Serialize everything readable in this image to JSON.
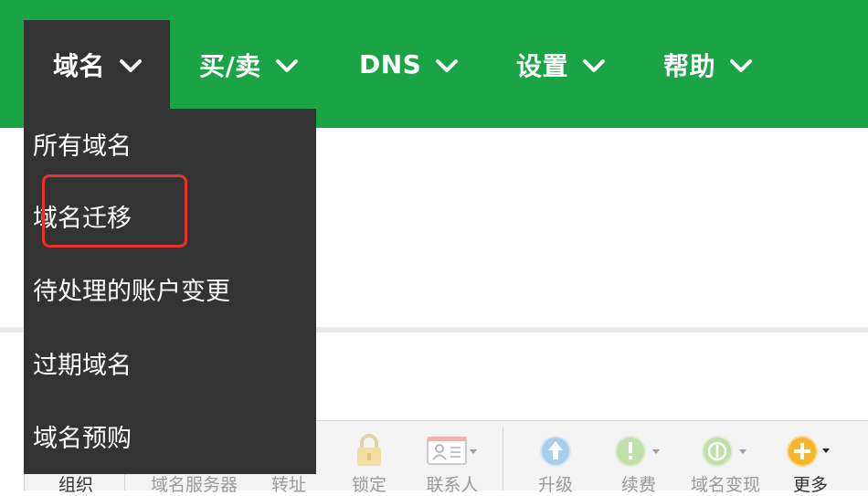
{
  "nav": {
    "items": [
      {
        "label": "域名",
        "active": true
      },
      {
        "label": "买/卖",
        "active": false
      },
      {
        "label": "DNS",
        "active": false
      },
      {
        "label": "设置",
        "active": false
      },
      {
        "label": "帮助",
        "active": false
      }
    ]
  },
  "dropdown": {
    "items": [
      {
        "label": "所有域名"
      },
      {
        "label": "域名迁移",
        "highlighted": true
      },
      {
        "label": "待处理的账户变更"
      },
      {
        "label": "过期域名"
      },
      {
        "label": "域名预购"
      }
    ]
  },
  "toolbar": {
    "items": [
      {
        "label": "组织",
        "icon": "org-icon"
      },
      {
        "label": "域名服务器",
        "icon": "nameserver-icon"
      },
      {
        "label": "转址",
        "icon": "forward-icon"
      },
      {
        "label": "锁定",
        "icon": "lock-icon"
      },
      {
        "label": "联系人",
        "icon": "contact-card-icon"
      },
      {
        "label": "升级",
        "icon": "upgrade-arrow-icon"
      },
      {
        "label": "续费",
        "icon": "renew-icon"
      },
      {
        "label": "域名变现",
        "icon": "dollar-icon"
      },
      {
        "label": "更多",
        "icon": "plus-more-icon"
      }
    ]
  },
  "colors": {
    "nav_bg": "#1ba446",
    "dropdown_bg": "#333333",
    "highlight_border": "#e8322b",
    "toolbar_bg": "#f3f3f3"
  }
}
